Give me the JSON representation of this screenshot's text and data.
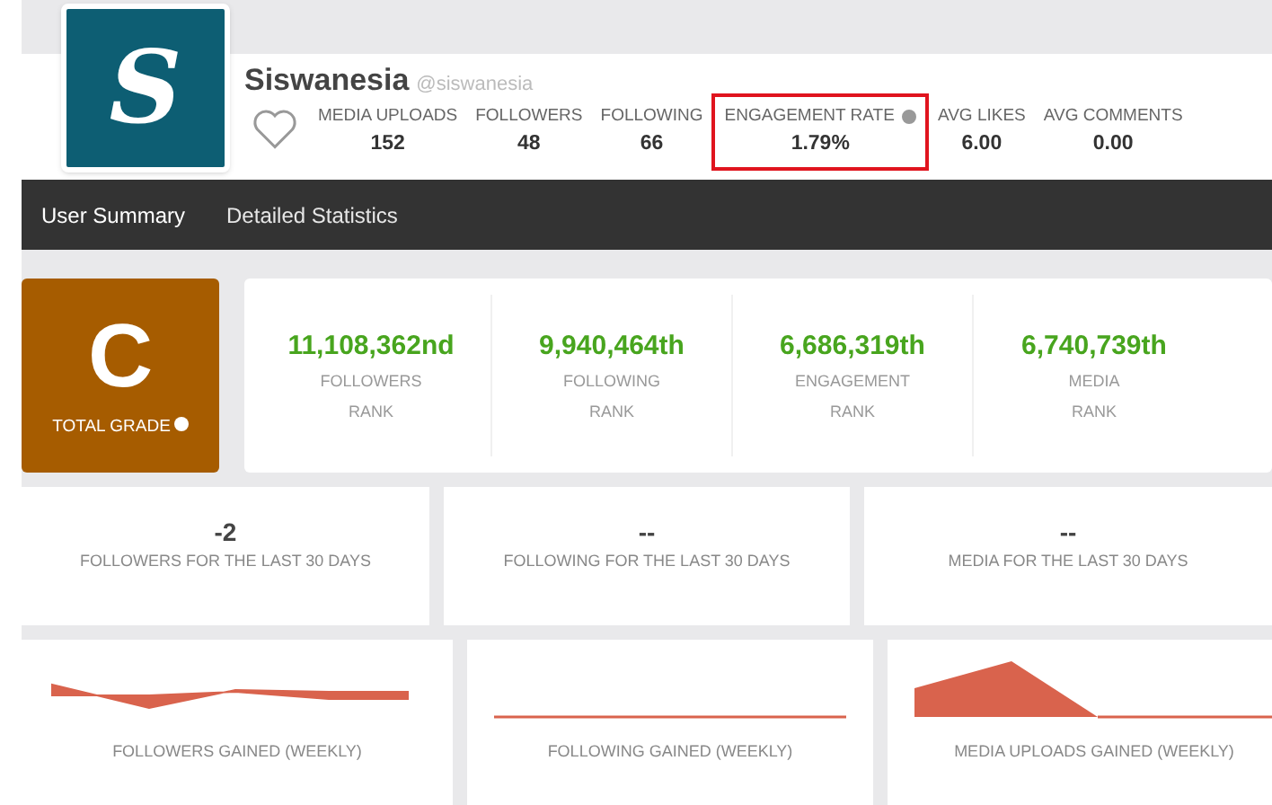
{
  "profile": {
    "name": "Siswanesia",
    "handle": "@siswanesia",
    "logo_letter": "S",
    "favorited": false
  },
  "stats": [
    {
      "label": "MEDIA UPLOADS",
      "value": "152",
      "help": false,
      "highlighted": false
    },
    {
      "label": "FOLLOWERS",
      "value": "48",
      "help": false,
      "highlighted": false
    },
    {
      "label": "FOLLOWING",
      "value": "66",
      "help": false,
      "highlighted": false
    },
    {
      "label": "ENGAGEMENT RATE",
      "value": "1.79%",
      "help": true,
      "highlighted": true
    },
    {
      "label": "AVG LIKES",
      "value": "6.00",
      "help": false,
      "highlighted": false
    },
    {
      "label": "AVG COMMENTS",
      "value": "0.00",
      "help": false,
      "highlighted": false
    }
  ],
  "tabs": [
    {
      "label": "User Summary",
      "selected": true
    },
    {
      "label": "Detailed Statistics",
      "selected": false
    }
  ],
  "grade": {
    "letter": "C",
    "label": "TOTAL GRADE",
    "color": "#a65c00"
  },
  "ranks": [
    {
      "value": "11,108,362nd",
      "label": "FOLLOWERS",
      "sub": "RANK"
    },
    {
      "value": "9,940,464th",
      "label": "FOLLOWING",
      "sub": "RANK"
    },
    {
      "value": "6,686,319th",
      "label": "ENGAGEMENT",
      "sub": "RANK"
    },
    {
      "value": "6,740,739th",
      "label": "MEDIA",
      "sub": "RANK"
    }
  ],
  "period_stats": [
    {
      "value": "-2",
      "label": "FOLLOWERS FOR THE LAST 30 DAYS"
    },
    {
      "value": "--",
      "label": "FOLLOWING FOR THE LAST 30 DAYS"
    },
    {
      "value": "--",
      "label": "MEDIA FOR THE LAST 30 DAYS"
    }
  ],
  "weekly_charts": [
    {
      "kind": "dip",
      "label": "FOLLOWERS GAINED (WEEKLY)"
    },
    {
      "kind": "flat",
      "label": "FOLLOWING GAINED (WEEKLY)"
    },
    {
      "kind": "peak",
      "label": "MEDIA UPLOADS GAINED (WEEKLY)"
    }
  ]
}
